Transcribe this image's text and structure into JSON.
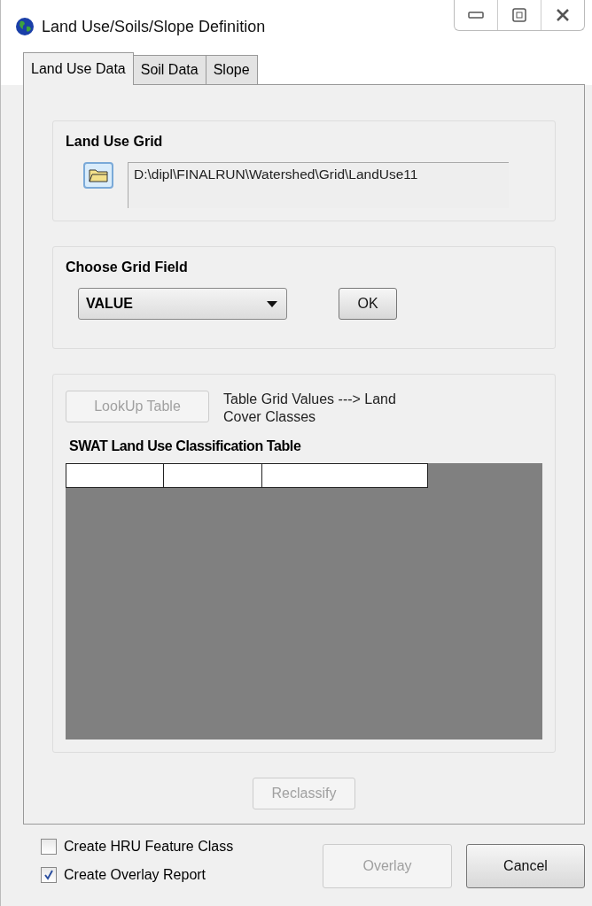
{
  "window": {
    "title": "Land Use/Soils/Slope Definition"
  },
  "tabs": [
    {
      "label": "Land Use Data",
      "selected": true
    },
    {
      "label": "Soil Data",
      "selected": false
    },
    {
      "label": "Slope",
      "selected": false
    }
  ],
  "land_use_grid": {
    "title": "Land Use Grid",
    "path": "D:\\dipl\\FINALRUN\\Watershed\\Grid\\LandUse11"
  },
  "grid_field": {
    "title": "Choose Grid Field",
    "value": "VALUE",
    "ok_button": {
      "label": "OK",
      "disabled": false
    }
  },
  "lookup": {
    "button": {
      "label": "LookUp Table",
      "disabled": true
    },
    "description": "Table Grid Values ---> Land Cover Classes",
    "table_title": "SWAT Land Use Classification Table",
    "column_count_cells": [
      {
        "kind": "header"
      },
      {
        "kind": "header"
      },
      {
        "kind": "header"
      }
    ],
    "reclassify_button": {
      "label": "Reclassify",
      "disabled": true
    }
  },
  "options": [
    {
      "label": "Create HRU Feature Class",
      "checked": false
    },
    {
      "label": "Create Overlay Report",
      "checked": true
    }
  ],
  "buttons": [
    {
      "label": "Overlay",
      "disabled": true
    },
    {
      "label": "Cancel",
      "disabled": false
    }
  ]
}
